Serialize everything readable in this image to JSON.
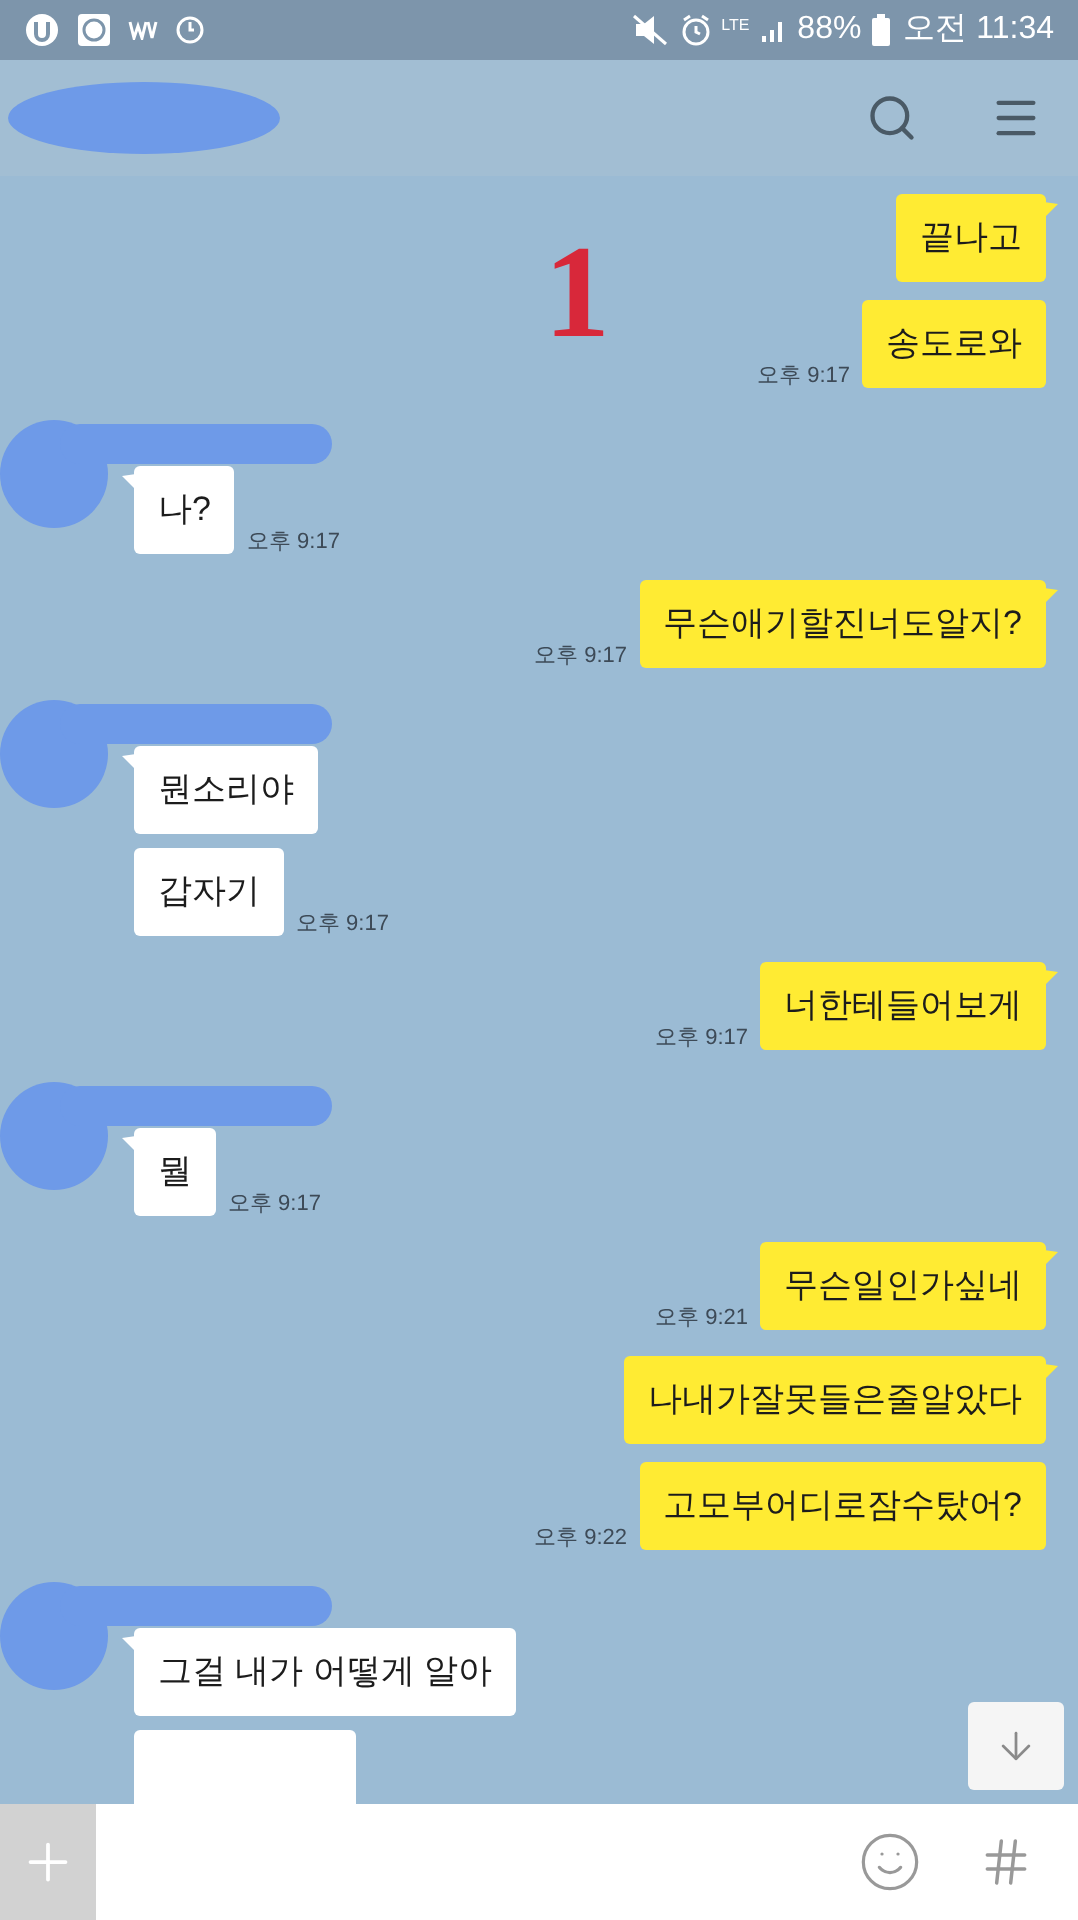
{
  "status_bar": {
    "network": "LTE",
    "battery": "88%",
    "time": "오전 11:34"
  },
  "annotation": "1",
  "messages": [
    {
      "kind": "sent",
      "bubbles": [
        "끝나고",
        "송도로와"
      ],
      "time": "오후 9:17"
    },
    {
      "kind": "received",
      "bubbles": [
        "나?"
      ],
      "time": "오후 9:17"
    },
    {
      "kind": "sent",
      "bubbles": [
        "무슨애기할진너도알지?"
      ],
      "time": "오후 9:17"
    },
    {
      "kind": "received",
      "bubbles": [
        "뭔소리야",
        "갑자기"
      ],
      "time": "오후 9:17"
    },
    {
      "kind": "sent",
      "bubbles": [
        "너한테들어보게"
      ],
      "time": "오후 9:17"
    },
    {
      "kind": "received",
      "bubbles": [
        "뭘"
      ],
      "time": "오후 9:17"
    },
    {
      "kind": "sent",
      "bubbles": [
        "무슨일인가싶네"
      ],
      "time": "오후 9:21"
    },
    {
      "kind": "sent",
      "bubbles": [
        "나내가잘못들은줄알았다",
        "고모부어디로잠수탔어?"
      ],
      "time": "오후 9:22"
    },
    {
      "kind": "received",
      "bubbles": [
        "그걸 내가 어떻게 알아"
      ],
      "cut_bubble_below": true
    }
  ]
}
